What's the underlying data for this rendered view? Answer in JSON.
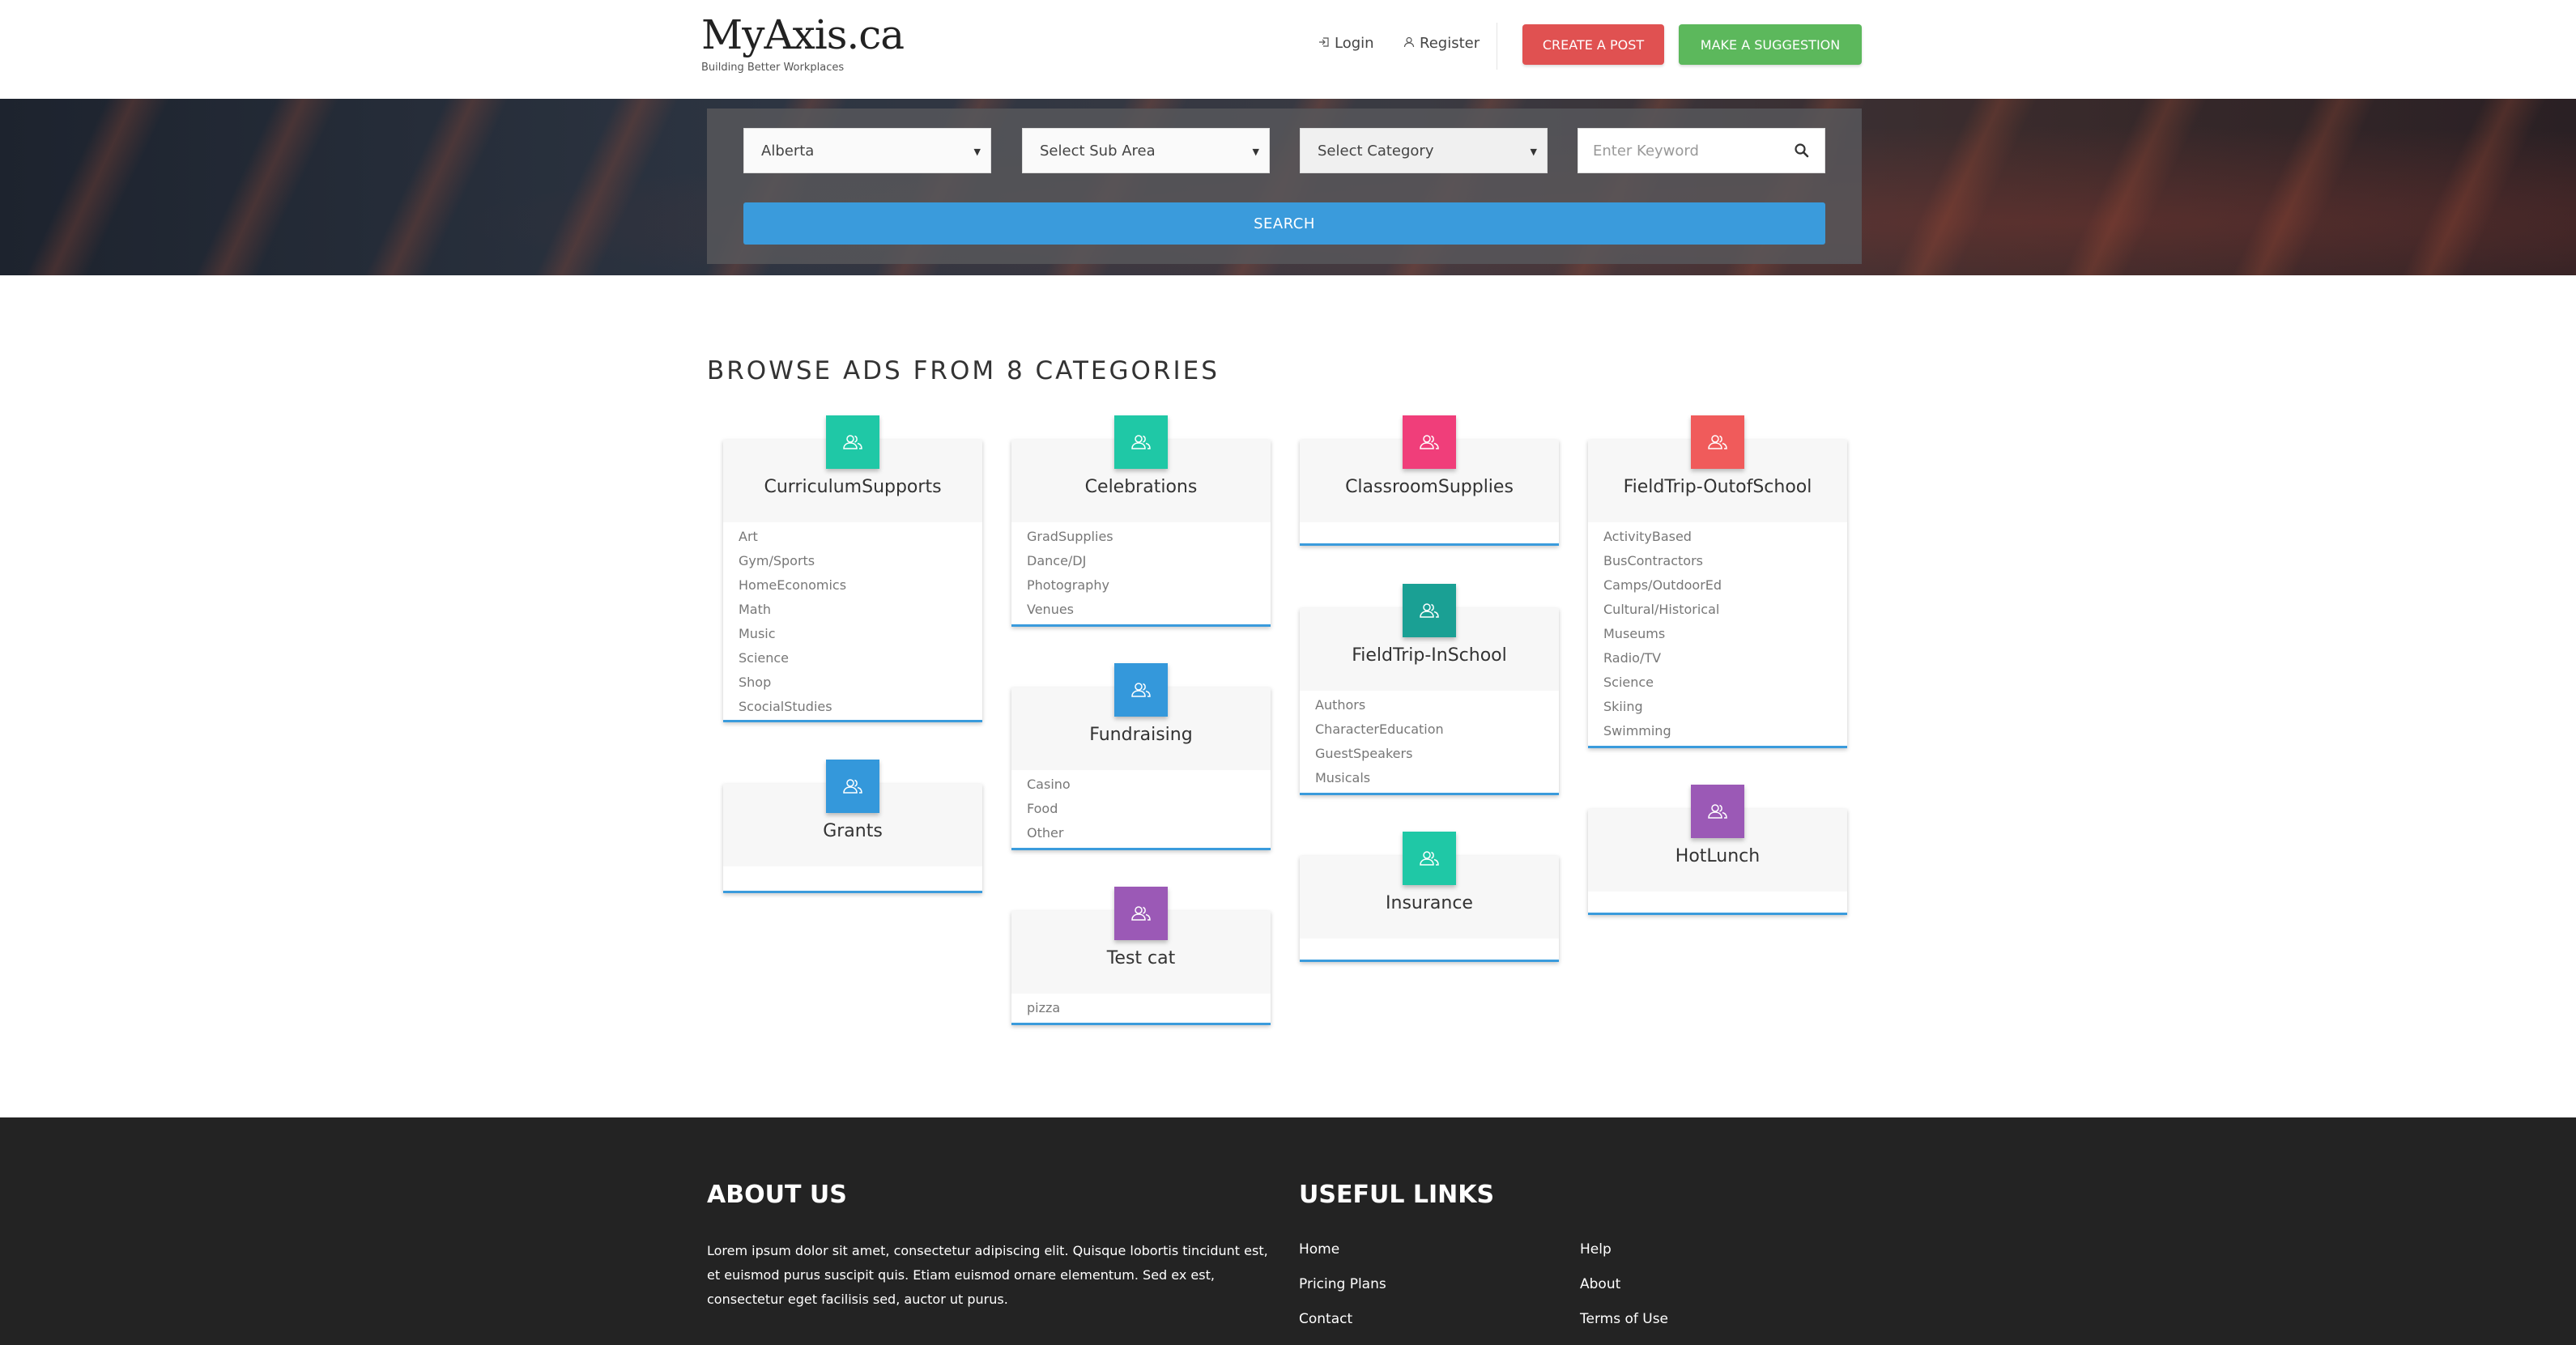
{
  "header": {
    "logo": "MyAxis.ca",
    "tagline": "Building Better Workplaces",
    "login_label": "Login",
    "register_label": "Register",
    "create_post_label": "CREATE A POST",
    "suggestion_label": "MAKE A SUGGESTION"
  },
  "search": {
    "province_value": "Alberta",
    "subarea_placeholder": "Select Sub Area",
    "category_placeholder": "Select Category",
    "keyword_placeholder": "Enter Keyword",
    "search_label": "SEARCH"
  },
  "browse_title": "BROWSE ADS FROM 8 CATEGORIES",
  "categories": [
    {
      "title": "CurriculumSupports",
      "icon_color": "#1fc8a6",
      "subs": [
        "Art",
        "Gym/Sports",
        "HomeEconomics",
        "Math",
        "Music",
        "Science",
        "Shop",
        "ScocialStudies"
      ]
    },
    {
      "title": "Grants",
      "icon_color": "#3498db",
      "subs": []
    },
    {
      "title": "Celebrations",
      "icon_color": "#1fc8a6",
      "subs": [
        "GradSupplies",
        "Dance/DJ",
        "Photography",
        "Venues"
      ]
    },
    {
      "title": "Fundraising",
      "icon_color": "#3498db",
      "subs": [
        "Casino",
        "Food",
        "Other"
      ]
    },
    {
      "title": "Test cat",
      "icon_color": "#9b59b6",
      "subs": [
        "pizza"
      ]
    },
    {
      "title": "ClassroomSupplies",
      "icon_color": "#f03e7a",
      "subs": []
    },
    {
      "title": "FieldTrip-InSchool",
      "icon_color": "#1aa094",
      "subs": [
        "Authors",
        "CharacterEducation",
        "GuestSpeakers",
        "Musicals"
      ]
    },
    {
      "title": "Insurance",
      "icon_color": "#1fc8a6",
      "subs": []
    },
    {
      "title": "FieldTrip-OutofSchool",
      "icon_color": "#f05b5b",
      "subs": [
        "ActivityBased",
        "BusContractors",
        "Camps/OutdoorEd",
        "Cultural/Historical",
        "Museums",
        "Radio/TV",
        "Science",
        "Skiing",
        "Swimming"
      ]
    },
    {
      "title": "HotLunch",
      "icon_color": "#9b59b6",
      "subs": []
    }
  ],
  "footer": {
    "about_heading": "ABOUT US",
    "about_text": "Lorem ipsum dolor sit amet, consectetur adipiscing elit. Quisque lobortis tincidunt est, et euismod purus suscipit quis. Etiam euismod ornare elementum. Sed ex est, consectetur eget facilisis sed, auctor ut purus.",
    "links_heading": "USEFUL LINKS",
    "links": [
      "Home",
      "Pricing Plans",
      "Contact",
      "Help",
      "About",
      "Terms of Use"
    ]
  },
  "colors": {
    "create_post": "#e05151",
    "suggestion": "#5cb85c",
    "search_button": "#3a9bdc",
    "footer_bg": "#232323"
  }
}
